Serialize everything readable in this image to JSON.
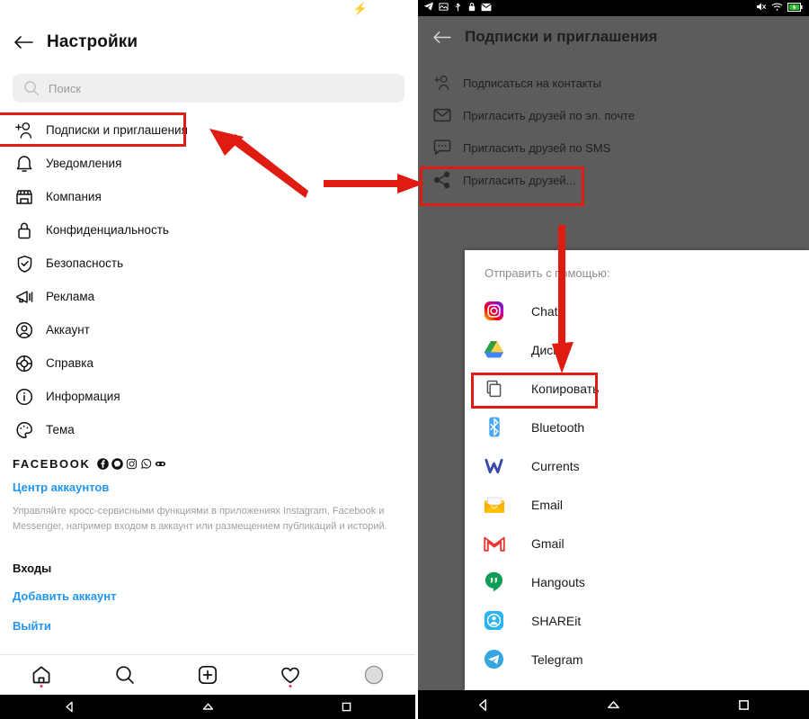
{
  "left_phone": {
    "status_bar": {
      "battery_icon": "lightning-bolt-icon"
    },
    "header": {
      "back_icon": "back-arrow-icon",
      "title": "Настройки"
    },
    "search": {
      "icon": "search-icon",
      "placeholder": "Поиск",
      "value": ""
    },
    "settings_items": [
      {
        "icon": "follow-invite-icon",
        "label": "Подписки и приглашения",
        "highlighted": true
      },
      {
        "icon": "bell-icon",
        "label": "Уведомления"
      },
      {
        "icon": "store-icon",
        "label": "Компания"
      },
      {
        "icon": "lock-icon",
        "label": "Конфиденциальность"
      },
      {
        "icon": "shield-check-icon",
        "label": "Безопасность"
      },
      {
        "icon": "megaphone-icon",
        "label": "Реклама"
      },
      {
        "icon": "account-circle-icon",
        "label": "Аккаунт"
      },
      {
        "icon": "lifebuoy-icon",
        "label": "Справка"
      },
      {
        "icon": "info-icon",
        "label": "Информация"
      },
      {
        "icon": "palette-icon",
        "label": "Тема"
      }
    ],
    "facebook_section": {
      "word": "FACEBOOK",
      "brand_icons": [
        "facebook-icon",
        "messenger-icon",
        "instagram-icon",
        "whatsapp-icon",
        "oculus-icon"
      ],
      "accounts_center_link": "Центр аккаунтов",
      "description": "Управляйте кросс-сервисными функциями в приложениях Instagram, Facebook и Messenger, например входом в аккаунт или размещением публикаций и историй.",
      "logins_heading": "Входы",
      "add_account_link": "Добавить аккаунт",
      "logout_link": "Выйти"
    },
    "tab_bar": [
      {
        "icon": "home-icon",
        "badge": true
      },
      {
        "icon": "search-icon",
        "badge": false
      },
      {
        "icon": "add-post-icon",
        "badge": false
      },
      {
        "icon": "heart-icon",
        "badge": true
      },
      {
        "icon": "profile-avatar-icon",
        "badge": false
      }
    ],
    "nav_bar": [
      "back-nav-icon",
      "home-nav-icon",
      "recents-nav-icon"
    ]
  },
  "right_phone": {
    "status_bar": {
      "left_icons": [
        "telegram-icon",
        "screenshot-icon",
        "usb-icon",
        "lock-icon",
        "mail-icon"
      ],
      "right_icons": [
        "mute-icon",
        "wifi-icon",
        "battery-charging-icon"
      ]
    },
    "header": {
      "back_icon": "back-arrow-icon",
      "title": "Подписки и приглашения"
    },
    "invite_items": [
      {
        "icon": "follow-invite-icon",
        "label": "Подписаться на контакты"
      },
      {
        "icon": "envelope-icon",
        "label": "Пригласить друзей по эл. почте"
      },
      {
        "icon": "sms-bubble-icon",
        "label": "Пригласить друзей по SMS"
      },
      {
        "icon": "share-icon",
        "label": "Пригласить друзей...",
        "highlighted": true
      }
    ],
    "share_sheet": {
      "title": "Отправить с помощью:",
      "apps": [
        {
          "icon": "instagram-icon",
          "label": "Chats"
        },
        {
          "icon": "google-drive-icon",
          "label": "Диск"
        },
        {
          "icon": "copy-icon",
          "label": "Копировать",
          "highlighted": true
        },
        {
          "icon": "bluetooth-icon",
          "label": "Bluetooth"
        },
        {
          "icon": "currents-icon",
          "label": "Currents"
        },
        {
          "icon": "email-icon",
          "label": "Email"
        },
        {
          "icon": "gmail-icon",
          "label": "Gmail"
        },
        {
          "icon": "hangouts-icon",
          "label": "Hangouts"
        },
        {
          "icon": "shareit-icon",
          "label": "SHAREit"
        },
        {
          "icon": "telegram-icon",
          "label": "Telegram"
        }
      ]
    },
    "nav_bar": [
      "back-nav-icon",
      "home-nav-icon",
      "recents-nav-icon"
    ]
  },
  "annotations": {
    "highlight_color": "#e01b11",
    "arrows": [
      {
        "name": "arrow-to-follow-invite",
        "direction": "up-left"
      },
      {
        "name": "arrow-to-right-phone",
        "direction": "right"
      },
      {
        "name": "arrow-to-copy",
        "direction": "down"
      }
    ]
  }
}
